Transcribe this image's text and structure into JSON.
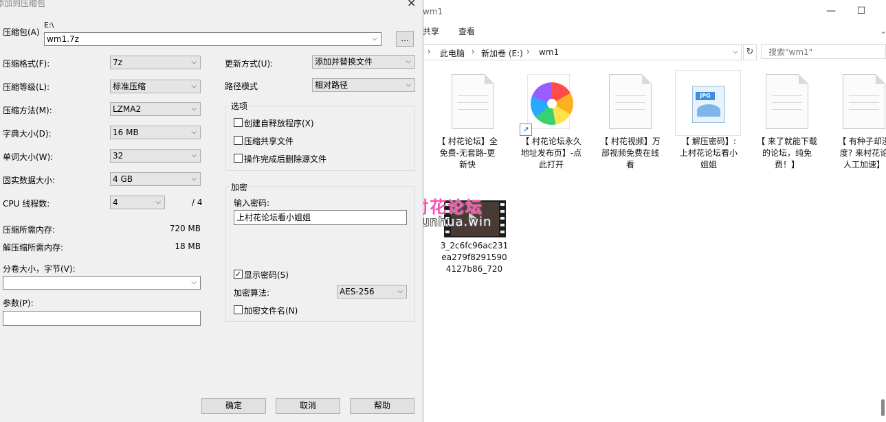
{
  "explorer": {
    "title": "wm1",
    "controls": {
      "minimize": "—",
      "maximize": "☐",
      "close": "✕"
    },
    "ribbon_tabs": [
      "共享",
      "查看"
    ],
    "breadcrumb": [
      "此电脑",
      "新加卷 (E:)",
      "wm1"
    ],
    "breadcrumb_sep": "›",
    "search_placeholder": "搜索\"wm1\"",
    "files": [
      {
        "name": "【 村花论坛】全\n免费-无套路-更\n新快",
        "icon": "document-icon"
      },
      {
        "name": "【 村花论坛永久\n地址发布页】-点\n此打开",
        "icon": "pinwheel-shortcut-icon"
      },
      {
        "name": "【 村花视频】万\n部视频免费在线\n看",
        "icon": "document-icon"
      },
      {
        "name": "【 解压密码】:\n上村花论坛看小\n姐姐",
        "icon": "jpg-image-icon"
      },
      {
        "name": "【 来了就能下载\n的论坛，纯免\n费！】",
        "icon": "document-icon"
      },
      {
        "name": "【 有种子却没\n度? 来村花论\n人工加速】",
        "icon": "document-icon"
      },
      {
        "name": "3_2c6fc96ac231\nea279f8291590\n4127b86_720",
        "icon": "video-thumbnail-icon"
      }
    ]
  },
  "watermark": {
    "text": "村花论坛",
    "url": "cunhua.win"
  },
  "dialog": {
    "title": "添加到压缩包",
    "archive_label": "压缩包(A)",
    "archive_dir": "E:\\",
    "archive_name": "wm1.7z",
    "browse_label": "...",
    "format_label": "压缩格式(F):",
    "format_value": "7z",
    "level_label": "压缩等级(L):",
    "level_value": "标准压缩",
    "method_label": "压缩方法(M):",
    "method_value": "LZMA2",
    "dict_label": "字典大小(D):",
    "dict_value": "16 MB",
    "word_label": "单词大小(W):",
    "word_value": "32",
    "solid_label": "固实数据大小:",
    "solid_value": "4 GB",
    "threads_label": "CPU 线程数:",
    "threads_value": "4",
    "threads_total": "/ 4",
    "mem_comp_label": "压缩所需内存:",
    "mem_comp_value": "720 MB",
    "mem_decomp_label": "解压缩所需内存:",
    "mem_decomp_value": "18 MB",
    "volume_label": "分卷大小，字节(V):",
    "volume_value": "",
    "params_label": "参数(P):",
    "params_value": "",
    "update_label": "更新方式(U):",
    "update_value": "添加并替换文件",
    "path_label": "路径模式",
    "path_value": "相对路径",
    "options_group": "选项",
    "opt_sfx": "创建自释放程序(X)",
    "opt_shared": "压缩共享文件",
    "opt_delete": "操作完成后删除源文件",
    "encrypt_group": "加密",
    "password_label": "输入密码:",
    "password_value": "上村花论坛看小姐姐",
    "show_password": "显示密码(S)",
    "show_password_check": "✓",
    "enc_method_label": "加密算法:",
    "enc_method_value": "AES-256",
    "encrypt_names": "加密文件名(N)",
    "ok_label": "确定",
    "cancel_label": "取消",
    "help_label": "帮助"
  }
}
